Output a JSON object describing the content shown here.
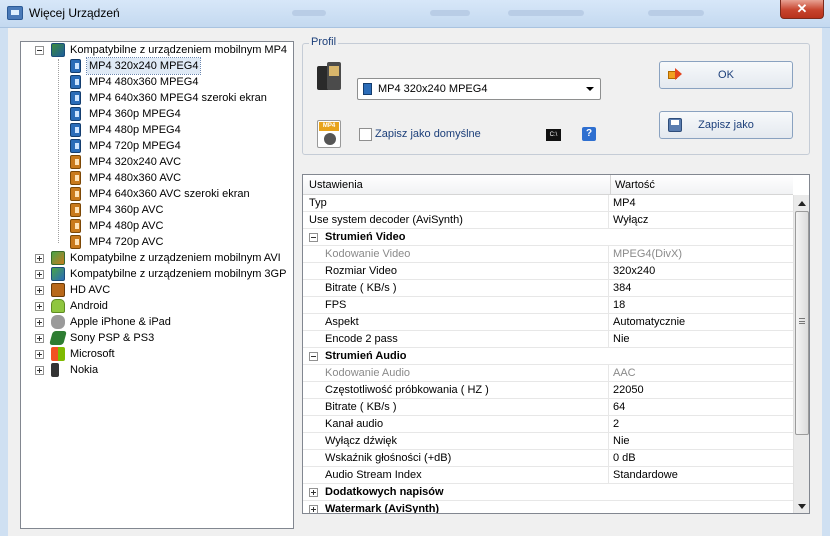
{
  "window": {
    "title": "Więcej Urządzeń",
    "close_label": "✕"
  },
  "tree": {
    "groups": [
      {
        "label": "Kompatybilne z urządzeniem mobilnym MP4",
        "icon": "mp4-device-icon",
        "expanded": true,
        "children": [
          {
            "label": "MP4 320x240 MPEG4",
            "icon": "mpeg4-file-icon",
            "selected": true
          },
          {
            "label": "MP4 480x360 MPEG4",
            "icon": "mpeg4-file-icon"
          },
          {
            "label": "MP4 640x360 MPEG4 szeroki ekran",
            "icon": "mpeg4-file-icon"
          },
          {
            "label": "MP4 360p MPEG4",
            "icon": "mpeg4-file-icon"
          },
          {
            "label": "MP4 480p MPEG4",
            "icon": "mpeg4-file-icon"
          },
          {
            "label": "MP4 720p MPEG4",
            "icon": "mpeg4-file-icon"
          },
          {
            "label": "MP4 320x240 AVC",
            "icon": "avc-file-icon"
          },
          {
            "label": "MP4 480x360 AVC",
            "icon": "avc-file-icon"
          },
          {
            "label": "MP4 640x360 AVC szeroki ekran",
            "icon": "avc-file-icon"
          },
          {
            "label": "MP4 360p AVC",
            "icon": "avc-file-icon"
          },
          {
            "label": "MP4 480p AVC",
            "icon": "avc-file-icon"
          },
          {
            "label": "MP4 720p AVC",
            "icon": "avc-file-icon"
          }
        ]
      },
      {
        "label": "Kompatybilne z urządzeniem mobilnym AVI",
        "icon": "avi-device-icon"
      },
      {
        "label": "Kompatybilne z urządzeniem mobilnym 3GP",
        "icon": "3gp-device-icon"
      },
      {
        "label": "HD AVC",
        "icon": "hd-avc-icon"
      },
      {
        "label": "Android",
        "icon": "android-icon"
      },
      {
        "label": "Apple iPhone & iPad",
        "icon": "apple-icon"
      },
      {
        "label": "Sony PSP & PS3",
        "icon": "sony-psp-icon"
      },
      {
        "label": "Microsoft",
        "icon": "microsoft-icon"
      },
      {
        "label": "Nokia",
        "icon": "nokia-icon"
      }
    ]
  },
  "profile": {
    "group_label": "Profil",
    "selected": "MP4 320x240 MPEG4",
    "default_checkbox_label": "Zapisz jako domyślne",
    "default_checked": false,
    "cmd_label": "C:\\",
    "help_label": "?",
    "ok_label": "OK",
    "save_as_label": "Zapisz jako"
  },
  "grid": {
    "col_setting": "Ustawienia",
    "col_value": "Wartość",
    "rows": [
      {
        "kind": "prop",
        "key": "Typ",
        "value": "MP4"
      },
      {
        "kind": "prop",
        "key": "Use system decoder (AviSynth)",
        "value": "Wyłącz"
      },
      {
        "kind": "cat",
        "key": "Strumień Video",
        "expanded": true
      },
      {
        "kind": "sub",
        "key": "Kodowanie Video",
        "value": "MPEG4(DivX)",
        "disabled": true
      },
      {
        "kind": "sub",
        "key": "Rozmiar Video",
        "value": "320x240"
      },
      {
        "kind": "sub",
        "key": "Bitrate ( KB/s )",
        "value": "384"
      },
      {
        "kind": "sub",
        "key": "FPS",
        "value": "18"
      },
      {
        "kind": "sub",
        "key": "Aspekt",
        "value": "Automatycznie"
      },
      {
        "kind": "sub",
        "key": "Encode 2 pass",
        "value": "Nie"
      },
      {
        "kind": "cat",
        "key": "Strumień Audio",
        "expanded": true
      },
      {
        "kind": "sub",
        "key": "Kodowanie Audio",
        "value": "AAC",
        "disabled": true
      },
      {
        "kind": "sub",
        "key": "Częstotliwość próbkowania ( HZ )",
        "value": "22050"
      },
      {
        "kind": "sub",
        "key": "Bitrate ( KB/s )",
        "value": "64"
      },
      {
        "kind": "sub",
        "key": "Kanał audio",
        "value": "2"
      },
      {
        "kind": "sub",
        "key": "Wyłącz dźwięk",
        "value": "Nie"
      },
      {
        "kind": "sub",
        "key": "Wskaźnik głośności (+dB)",
        "value": "0 dB"
      },
      {
        "kind": "sub",
        "key": "Audio Stream Index",
        "value": "Standardowe"
      },
      {
        "kind": "cat",
        "key": "Dodatkowych napisów",
        "expanded": false
      },
      {
        "kind": "cat",
        "key": "Watermark (AviSynth)",
        "expanded": false
      }
    ]
  }
}
